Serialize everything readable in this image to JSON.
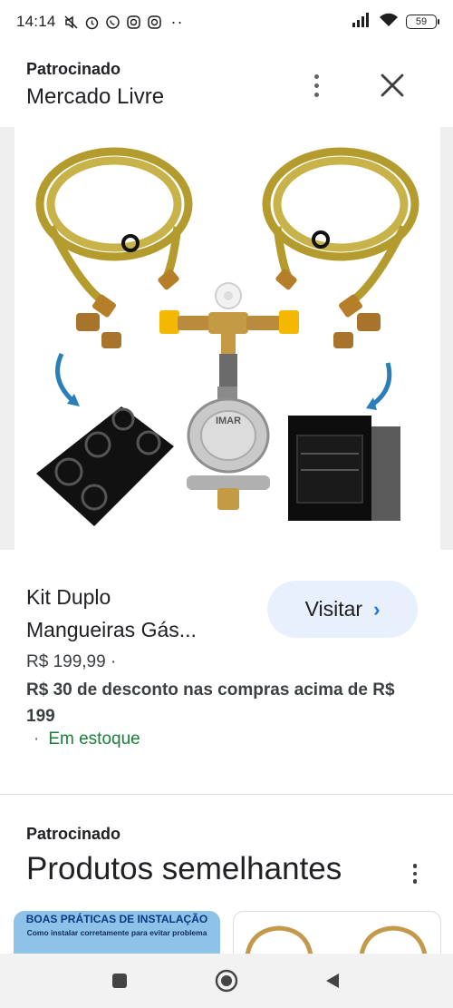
{
  "status_bar": {
    "time": "14:14",
    "battery": "59",
    "icons": [
      "mute-icon",
      "alarm-icon",
      "whatsapp-icon",
      "instagram-icon",
      "instagram-icon",
      "more-dots-icon",
      "signal-icon",
      "wifi-icon",
      "battery-icon"
    ],
    "more": "··"
  },
  "ad": {
    "sponsored_label": "Patrocinado",
    "merchant": "Mercado Livre"
  },
  "product": {
    "title_line1": "Kit Duplo",
    "title_line2": "Mangueiras Gás...",
    "price": "R$ 199,99  ·",
    "discount": "R$ 30 de desconto nas compras acima de R$ 199",
    "stock_dot": "·",
    "stock": "Em estoque",
    "visit_label": "Visitar",
    "visit_chevron": "›",
    "image_label": "IMAR"
  },
  "similar": {
    "sponsored_label": "Patrocinado",
    "title": "Produtos semelhantes",
    "card1_heading": "BOAS PRÁTICAS DE INSTALAÇÃO",
    "card1_sub": "Como instalar corretamente para evitar problema"
  },
  "colors": {
    "accent": "#1a73e8",
    "visit_bg": "#e8f0fe",
    "stock_green": "#188038",
    "hose_gold": "#b8a23a"
  }
}
